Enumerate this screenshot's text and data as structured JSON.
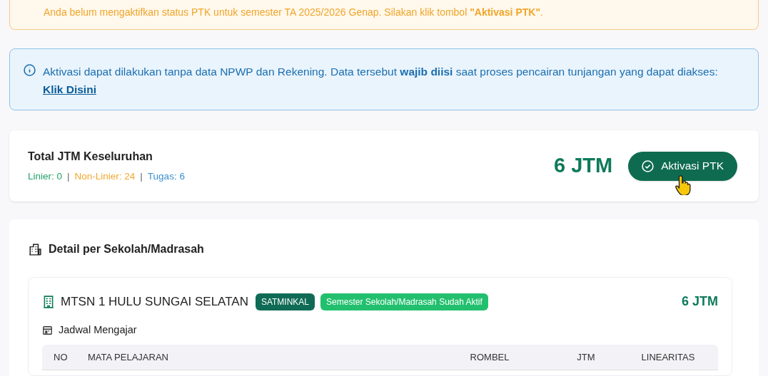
{
  "warning": {
    "text": "Anda belum mengaktifkan status PTK untuk semester TA 2025/2026 Genap. Silakan klik tombol **\"Aktivasi PTK\"**."
  },
  "info": {
    "text": "Aktivasi dapat dilakukan tanpa data NPWP dan Rekening. Data tersebut **wajib diisi** saat proses pencairan tunjangan yang dapat diakses:",
    "link": "Klik Disini"
  },
  "summary": {
    "title": "Total JTM Keseluruhan",
    "stats": [
      {
        "label": "Linier: 0",
        "color": "#22a06b"
      },
      {
        "label": "Non-Linier: 24",
        "color": "#f0a830"
      },
      {
        "label": "Tugas: 6",
        "color": "#3a8fd0"
      }
    ],
    "separator": "|",
    "total": "6 JTM",
    "button": "Aktivasi PTK"
  },
  "detail": {
    "title": "Detail per Sekolah/Madrasah",
    "schools": [
      {
        "name": "MTSN 1 HULU SUNGAI SELATAN",
        "badges": [
          {
            "label": "SATMINKAL",
            "kind": "dark"
          },
          {
            "label": "Semester Sekolah/Madrasah Sudah Aktif",
            "kind": "light"
          }
        ],
        "total": "6 JTM",
        "schedule_title": "Jadwal Mengajar",
        "table": {
          "columns": [
            "NO",
            "MATA PELAJARAN",
            "ROMBEL",
            "JTM",
            "LINEARITAS"
          ]
        }
      }
    ]
  }
}
